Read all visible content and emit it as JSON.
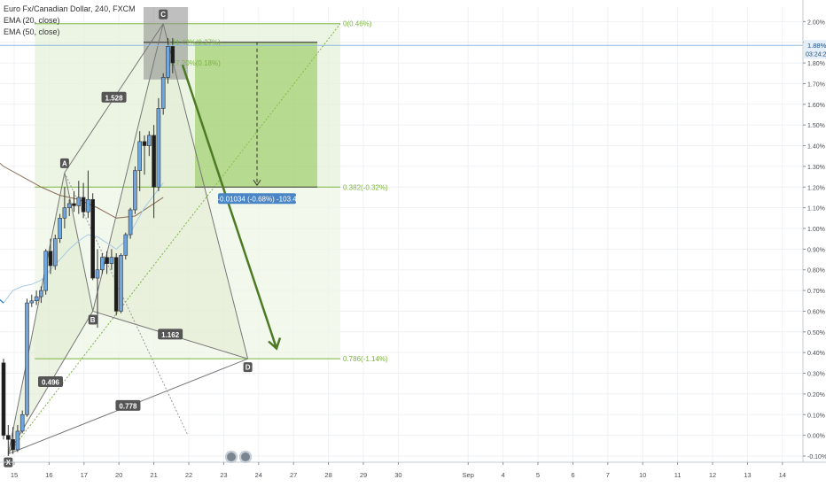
{
  "header": {
    "symbol": "Euro Fx/Canadian Dollar, 240, FXCM",
    "ema20": "EMA (20, close)",
    "ema50": "EMA (50, close)"
  },
  "colors": {
    "up_candle": "#6ea6e0",
    "down_candle": "#1c1c1c",
    "ema_blue": "#2f7ec8",
    "ema_brown": "#8b6f5a",
    "pattern_line": "#777777",
    "fib_green": "#7cb342",
    "target_box": "#8bc34a",
    "arrow": "#4d7a25",
    "price_line": "#8fb8e0",
    "label_dark": "#555555",
    "measure_label": "#4a86c5"
  },
  "chart_data": {
    "type": "candlestick",
    "y_unit": "percent",
    "ylim": [
      -0.13,
      2.07
    ],
    "y_ticks": [
      "2.00%",
      "1.90%",
      "1.80%",
      "1.70%",
      "1.60%",
      "1.50%",
      "1.40%",
      "1.30%",
      "1.20%",
      "1.10%",
      "1.00%",
      "0.90%",
      "0.80%",
      "0.70%",
      "0.60%",
      "0.50%",
      "0.40%",
      "0.30%",
      "0.20%",
      "0.10%",
      "0.00%",
      "-0.10%"
    ],
    "y_tick_values": [
      2.0,
      1.9,
      1.8,
      1.7,
      1.6,
      1.5,
      1.4,
      1.3,
      1.2,
      1.1,
      1.0,
      0.9,
      0.8,
      0.7,
      0.6,
      0.5,
      0.4,
      0.3,
      0.2,
      0.1,
      0.0,
      -0.1
    ],
    "x_ticks": [
      {
        "label": "15",
        "day": 15
      },
      {
        "label": "16",
        "day": 16
      },
      {
        "label": "17",
        "day": 17
      },
      {
        "label": "20",
        "day": 18
      },
      {
        "label": "21",
        "day": 19
      },
      {
        "label": "22",
        "day": 20
      },
      {
        "label": "23",
        "day": 21
      },
      {
        "label": "24",
        "day": 22
      },
      {
        "label": "27",
        "day": 23
      },
      {
        "label": "28",
        "day": 24
      },
      {
        "label": "29",
        "day": 25
      },
      {
        "label": "30",
        "day": 26
      },
      {
        "label": "Sep",
        "day": 28
      },
      {
        "label": "4",
        "day": 29
      },
      {
        "label": "5",
        "day": 30
      },
      {
        "label": "6",
        "day": 31
      },
      {
        "label": "7",
        "day": 32
      },
      {
        "label": "10",
        "day": 33
      },
      {
        "label": "11",
        "day": 34
      },
      {
        "label": "12",
        "day": 35
      },
      {
        "label": "13",
        "day": 36
      },
      {
        "label": "14",
        "day": 37
      }
    ],
    "current_price_label": "1.88%",
    "countdown_label": "03:24:22",
    "current_price": 1.885,
    "candles": [
      {
        "o": 0.35,
        "h": 0.37,
        "l": -0.02,
        "c": 0.0
      },
      {
        "o": 0.0,
        "h": 0.05,
        "l": -0.1,
        "c": -0.02
      },
      {
        "o": -0.02,
        "h": 0.04,
        "l": -0.09,
        "c": -0.07
      },
      {
        "o": -0.07,
        "h": 0.05,
        "l": -0.08,
        "c": 0.02
      },
      {
        "o": 0.02,
        "h": 0.12,
        "l": 0.01,
        "c": 0.1
      },
      {
        "o": 0.1,
        "h": 0.66,
        "l": 0.09,
        "c": 0.64
      },
      {
        "o": 0.64,
        "h": 0.68,
        "l": 0.62,
        "c": 0.65
      },
      {
        "o": 0.65,
        "h": 0.7,
        "l": 0.63,
        "c": 0.67
      },
      {
        "o": 0.67,
        "h": 0.72,
        "l": 0.64,
        "c": 0.7
      },
      {
        "o": 0.7,
        "h": 0.9,
        "l": 0.68,
        "c": 0.89
      },
      {
        "o": 0.89,
        "h": 0.95,
        "l": 0.78,
        "c": 0.82
      },
      {
        "o": 0.82,
        "h": 0.97,
        "l": 0.8,
        "c": 0.95
      },
      {
        "o": 0.95,
        "h": 1.07,
        "l": 0.93,
        "c": 1.05
      },
      {
        "o": 1.05,
        "h": 1.2,
        "l": 1.0,
        "c": 1.1
      },
      {
        "o": 1.1,
        "h": 1.14,
        "l": 1.06,
        "c": 1.12
      },
      {
        "o": 1.12,
        "h": 1.18,
        "l": 1.08,
        "c": 1.11
      },
      {
        "o": 1.11,
        "h": 1.23,
        "l": 1.07,
        "c": 1.15
      },
      {
        "o": 1.15,
        "h": 1.22,
        "l": 1.05,
        "c": 1.08
      },
      {
        "o": 1.08,
        "h": 1.28,
        "l": 1.05,
        "c": 1.14
      },
      {
        "o": 1.14,
        "h": 1.17,
        "l": 0.75,
        "c": 0.76
      },
      {
        "o": 0.76,
        "h": 0.9,
        "l": 0.52,
        "c": 0.8
      },
      {
        "o": 0.8,
        "h": 0.88,
        "l": 0.78,
        "c": 0.86
      },
      {
        "o": 0.86,
        "h": 0.89,
        "l": 0.78,
        "c": 0.83
      },
      {
        "o": 0.83,
        "h": 0.9,
        "l": 0.8,
        "c": 0.86
      },
      {
        "o": 0.86,
        "h": 0.88,
        "l": 0.58,
        "c": 0.6
      },
      {
        "o": 0.6,
        "h": 0.88,
        "l": 0.59,
        "c": 0.87
      },
      {
        "o": 0.87,
        "h": 0.98,
        "l": 0.85,
        "c": 0.97
      },
      {
        "o": 0.97,
        "h": 1.1,
        "l": 0.95,
        "c": 1.09
      },
      {
        "o": 1.09,
        "h": 1.3,
        "l": 1.07,
        "c": 1.28
      },
      {
        "o": 1.28,
        "h": 1.47,
        "l": 1.18,
        "c": 1.42
      },
      {
        "o": 1.42,
        "h": 1.45,
        "l": 1.26,
        "c": 1.4
      },
      {
        "o": 1.4,
        "h": 1.47,
        "l": 1.35,
        "c": 1.45
      },
      {
        "o": 1.45,
        "h": 1.5,
        "l": 1.05,
        "c": 1.2
      },
      {
        "o": 1.2,
        "h": 1.63,
        "l": 1.18,
        "c": 1.58
      },
      {
        "o": 1.58,
        "h": 1.75,
        "l": 1.55,
        "c": 1.73
      },
      {
        "o": 1.73,
        "h": 1.92,
        "l": 1.7,
        "c": 1.88
      },
      {
        "o": 1.88,
        "h": 1.92,
        "l": 1.75,
        "c": 1.8
      }
    ],
    "ema20_points": [
      [
        0,
        0.64
      ],
      [
        2,
        0.7
      ],
      [
        4,
        0.72
      ],
      [
        6,
        0.73
      ],
      [
        8,
        0.75
      ],
      [
        10,
        0.8
      ],
      [
        12,
        0.85
      ],
      [
        14,
        0.9
      ],
      [
        16,
        0.94
      ],
      [
        18,
        0.97
      ],
      [
        20,
        0.96
      ],
      [
        22,
        0.93
      ],
      [
        24,
        0.9
      ],
      [
        26,
        0.94
      ],
      [
        28,
        1.02
      ],
      [
        30,
        1.1
      ],
      [
        32,
        1.16
      ],
      [
        34,
        1.22
      ]
    ],
    "ema50_points": [
      [
        -12,
        1.62
      ],
      [
        -8,
        1.52
      ],
      [
        -4,
        1.38
      ],
      [
        0,
        1.3
      ],
      [
        4,
        1.25
      ],
      [
        8,
        1.2
      ],
      [
        12,
        1.16
      ],
      [
        16,
        1.14
      ],
      [
        20,
        1.1
      ],
      [
        24,
        1.05
      ],
      [
        28,
        1.06
      ],
      [
        32,
        1.12
      ],
      [
        34,
        1.15
      ]
    ],
    "ema_blue_left": [
      [
        -12,
        0.95
      ],
      [
        -8,
        0.88
      ],
      [
        -5,
        0.8
      ],
      [
        -3,
        0.72
      ],
      [
        -1,
        0.66
      ],
      [
        0,
        0.64
      ]
    ],
    "pattern": {
      "points": [
        {
          "name": "X",
          "bar": 1,
          "y": -0.09
        },
        {
          "name": "A",
          "bar": 13,
          "y": 1.27
        },
        {
          "name": "B",
          "bar": 19,
          "y": 0.6
        },
        {
          "name": "C",
          "bar": 34,
          "y": 1.99
        },
        {
          "name": "D",
          "bar": 52,
          "y": 0.37
        }
      ],
      "ratios": [
        {
          "label": "1.528",
          "from": "A",
          "to": "C"
        },
        {
          "label": "0.496",
          "from": "X",
          "to": "B"
        },
        {
          "label": "1.162",
          "from": "B",
          "to": "D"
        },
        {
          "label": "0.778",
          "from": "X",
          "to": "D"
        }
      ]
    },
    "fib_levels": [
      {
        "label": "0(0.46%)",
        "y": 1.99
      },
      {
        "label": "0.382(-0.32%)",
        "y": 1.2
      },
      {
        "label": "0.786(-1.14%)",
        "y": 0.37
      }
    ],
    "fib_inner_labels": [
      {
        "label": "141.42%(0.27%)",
        "y": 1.9
      },
      {
        "label": "127.20%(0.18%)",
        "y": 1.8
      }
    ],
    "measure": {
      "label": "-0.01034 (-0.68%) -103.4",
      "y_from": 1.9,
      "y_to": 1.2
    }
  }
}
